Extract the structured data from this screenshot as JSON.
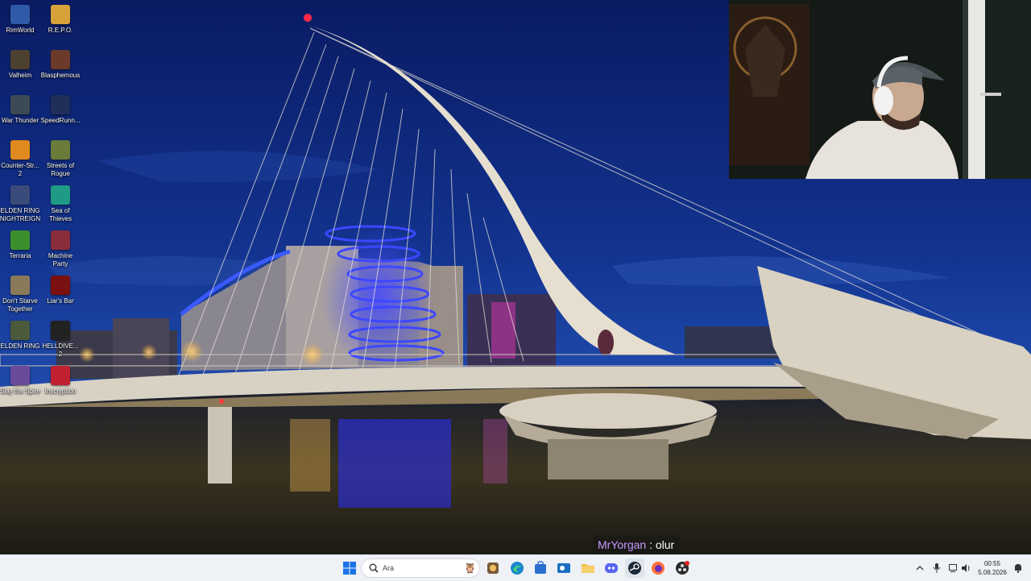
{
  "desktop": {
    "icons": [
      {
        "label": "RimWorld",
        "icon": "rimworld-icon",
        "color": "#2f5aa8"
      },
      {
        "label": "R.E.P.O.",
        "icon": "repo-icon",
        "color": "#d7a23a"
      },
      {
        "label": "Valheim",
        "icon": "valheim-icon",
        "color": "#4c4030"
      },
      {
        "label": "Blasphemous",
        "icon": "blasphemous-icon",
        "color": "#6b3a2a"
      },
      {
        "label": "War Thunder",
        "icon": "war-thunder-icon",
        "color": "#3c4a55"
      },
      {
        "label": "SpeedRunn...",
        "icon": "speedrunners-icon",
        "color": "#1f2f5a"
      },
      {
        "label": "Counter-Str...\n2",
        "icon": "counter-strike-icon",
        "color": "#e08a1e"
      },
      {
        "label": "Streets of\nRogue",
        "icon": "streets-of-rogue-icon",
        "color": "#6a7b3a"
      },
      {
        "label": "ELDEN RING\nNIGHTREIGN",
        "icon": "elden-ring-nightreign-icon",
        "color": "#3a4a7a"
      },
      {
        "label": "Sea of\nThieves",
        "icon": "sea-of-thieves-icon",
        "color": "#1f9a85"
      },
      {
        "label": "Terraria",
        "icon": "terraria-icon",
        "color": "#3d8f2e"
      },
      {
        "label": "Machine\nParty",
        "icon": "machine-party-icon",
        "color": "#8a2d3a"
      },
      {
        "label": "Don't Starve\nTogether",
        "icon": "dont-starve-icon",
        "color": "#8a7a5a"
      },
      {
        "label": "Liar's Bar",
        "icon": "liars-bar-icon",
        "color": "#7a1010"
      },
      {
        "label": "ELDEN RING",
        "icon": "elden-ring-icon",
        "color": "#4a5a3a"
      },
      {
        "label": "HELLDIVE...\n2",
        "icon": "helldivers-icon",
        "color": "#222222"
      },
      {
        "label": "Slay the Spire",
        "icon": "slay-the-spire-icon",
        "color": "#6a4a9a"
      },
      {
        "label": "Inscryption",
        "icon": "inscryption-icon",
        "color": "#c02030"
      }
    ]
  },
  "chat": {
    "username": "MrYorgan",
    "separator": " : ",
    "message": "olur"
  },
  "taskbar": {
    "search_placeholder": "Ara",
    "pinned": [
      {
        "name": "start-icon",
        "color": "#1a73e8"
      },
      {
        "name": "widgets-icon",
        "color": "#7a5a3a"
      },
      {
        "name": "copilot-icon",
        "color": "#3a9ad8"
      },
      {
        "name": "edge-icon",
        "color": "#1b86d0"
      },
      {
        "name": "store-icon",
        "color": "#2a6fd0"
      },
      {
        "name": "outlook-icon",
        "color": "#1b6fc0"
      },
      {
        "name": "file-explorer-icon",
        "color": "#f2c14b"
      },
      {
        "name": "discord-icon",
        "color": "#5865f2"
      },
      {
        "name": "steam-icon",
        "color": "#1b2838"
      },
      {
        "name": "firefox-icon",
        "color": "#ff7139"
      },
      {
        "name": "obs-icon",
        "color": "#2b2b2b"
      }
    ],
    "tray": {
      "chevron": "chevron-up-icon",
      "mic": "microphone-icon",
      "network": "network-icon",
      "volume": "volume-icon",
      "notification": "notification-icon"
    },
    "clock": {
      "time": "00:55",
      "date": "5.08.2026"
    }
  }
}
